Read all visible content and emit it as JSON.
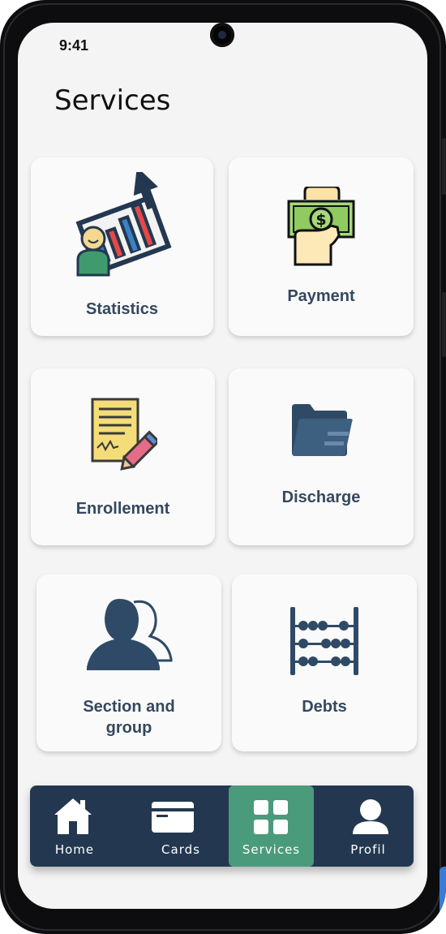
{
  "status_bar": {
    "time": "9:41"
  },
  "header": {
    "title": "Services"
  },
  "services": [
    {
      "id": "statistics",
      "label": "Statistics",
      "icon": "statistics-icon"
    },
    {
      "id": "payment",
      "label": "Payment",
      "icon": "payment-icon"
    },
    {
      "id": "enrollement",
      "label": "Enrollement",
      "icon": "enrollment-document-icon"
    },
    {
      "id": "discharge",
      "label": "Discharge",
      "icon": "folder-icon"
    },
    {
      "id": "section_group",
      "label_line1": "Section and",
      "label_line2": "group",
      "icon": "users-icon"
    },
    {
      "id": "debts",
      "label": "Debts",
      "icon": "abacus-icon"
    }
  ],
  "bottom_nav": {
    "items": [
      {
        "label": "Home",
        "icon": "home-icon"
      },
      {
        "label": "Cards",
        "icon": "card-icon"
      },
      {
        "label": "Services",
        "icon": "grid-icon",
        "active": true
      },
      {
        "label": "Profil",
        "icon": "profile-icon"
      }
    ]
  },
  "colors": {
    "nav_background": "#233850",
    "nav_active": "#4a9a7c",
    "card_label": "#34485e",
    "screen_background": "#f4f4f5"
  }
}
